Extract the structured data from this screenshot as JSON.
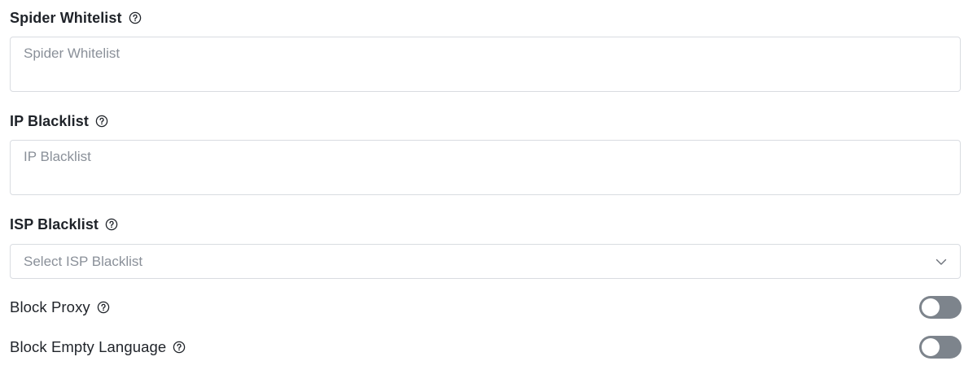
{
  "spider_whitelist": {
    "label": "Spider Whitelist",
    "placeholder": "Spider Whitelist",
    "value": ""
  },
  "ip_blacklist": {
    "label": "IP Blacklist",
    "placeholder": "IP Blacklist",
    "value": ""
  },
  "isp_blacklist": {
    "label": "ISP Blacklist",
    "placeholder": "Select ISP Blacklist"
  },
  "block_proxy": {
    "label": "Block Proxy",
    "enabled": false
  },
  "block_empty_language": {
    "label": "Block Empty Language",
    "enabled": false
  },
  "icons": {
    "help": "help-circle-icon",
    "dropdown": "chevron-down-icon"
  },
  "colors": {
    "toggle_off": "#7d848c",
    "border": "#d9dce1",
    "placeholder": "#8a9099",
    "label": "#1f2329"
  }
}
